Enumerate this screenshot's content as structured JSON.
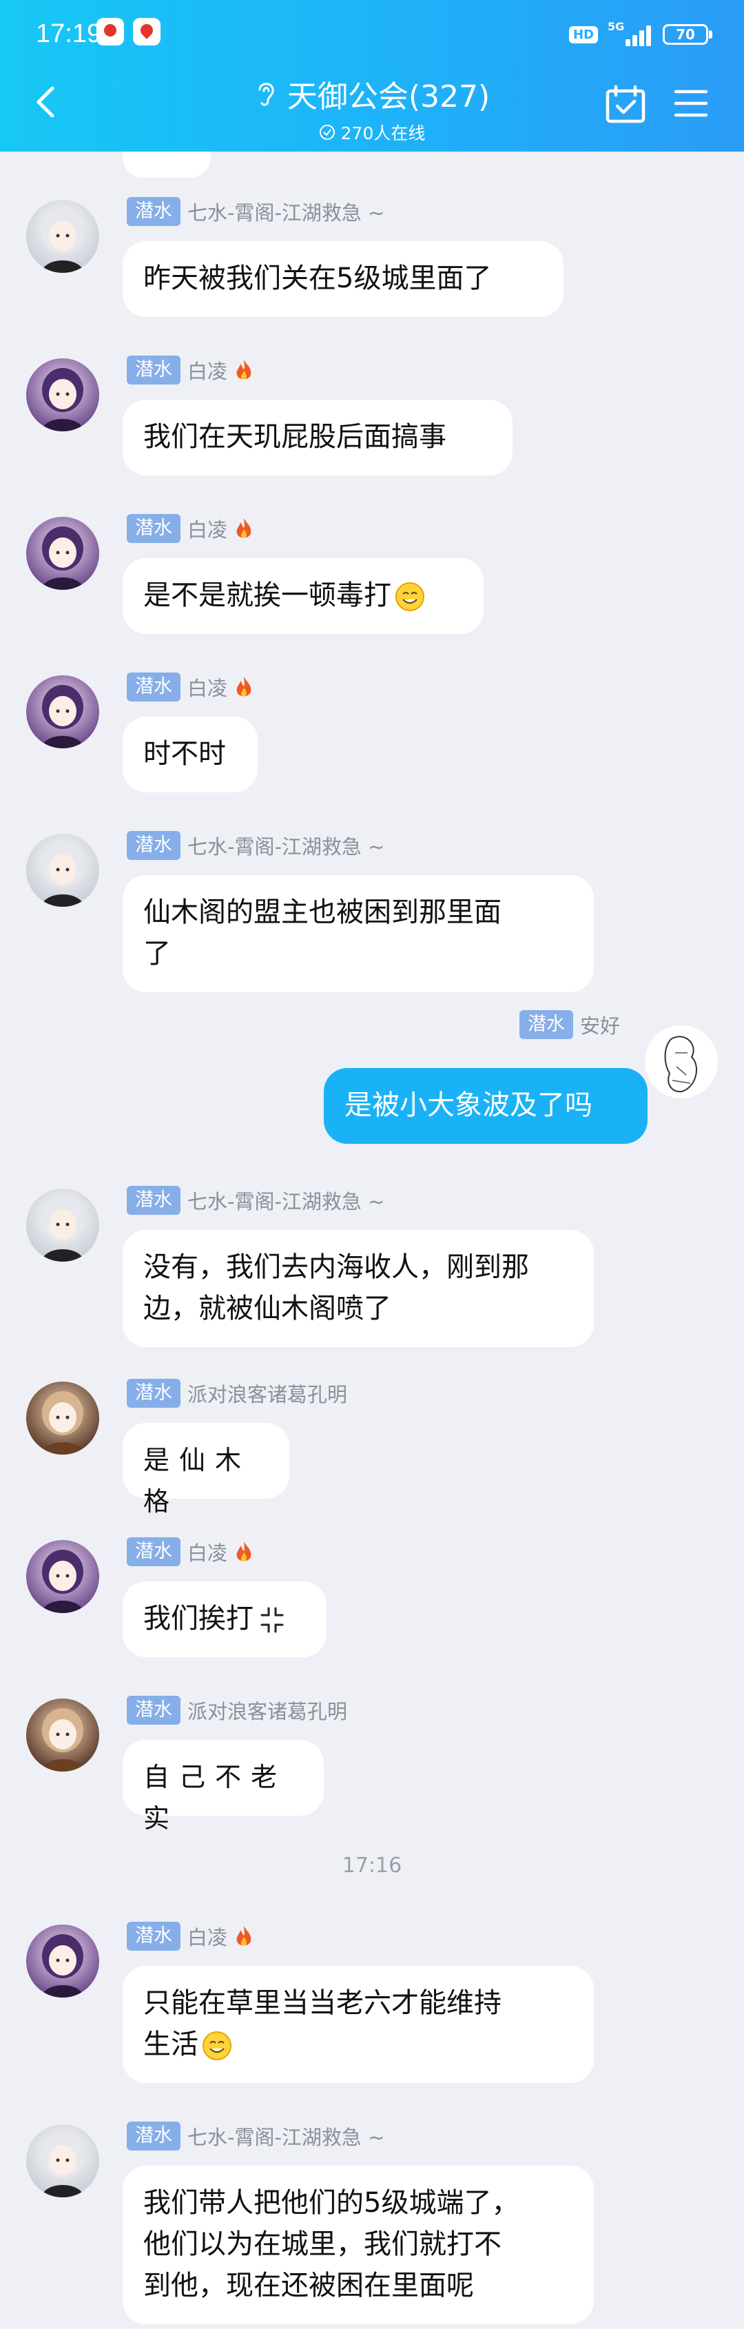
{
  "status": {
    "time": "17:19",
    "hd": "HD",
    "network": "5G",
    "battery": "70",
    "battery_level": 0.7
  },
  "header": {
    "title": "天御公会(327)",
    "online": "270人在线"
  },
  "messages": [
    {
      "tag": "潜水",
      "name": "七水-霄阁-江湖救急 ~",
      "text": "昨天被我们关在5级城里面了",
      "avatar": "silver-hair"
    },
    {
      "tag": "潜水",
      "name": "白凌",
      "fire": true,
      "text": "我们在天玑屁股后面搞事",
      "avatar": "purple-hair"
    },
    {
      "tag": "潜水",
      "name": "白凌",
      "fire": true,
      "text": "是不是就挨一顿毒打",
      "emoji": "smile",
      "avatar": "purple-hair"
    },
    {
      "tag": "潜水",
      "name": "白凌",
      "fire": true,
      "text": "时不时",
      "avatar": "purple-hair"
    },
    {
      "tag": "潜水",
      "name": "七水-霄阁-江湖救急 ~",
      "text": "仙木阁的盟主也被困到那里面\n了",
      "avatar": "silver-hair"
    },
    {
      "tag": "潜水",
      "name": "安好",
      "text": "是被小大象波及了吗",
      "mine": true,
      "avatar": "sketch"
    },
    {
      "tag": "潜水",
      "name": "七水-霄阁-江湖救急 ~",
      "text": "没有，我们去内海收人，刚到那\n边，就被仙木阁喷了",
      "avatar": "silver-hair"
    },
    {
      "tag": "潜水",
      "name": "派对浪客诸葛孔明",
      "text": "是仙木格",
      "hand": true,
      "avatar": "orange-hair"
    },
    {
      "tag": "潜水",
      "name": "白凌",
      "fire": true,
      "text": "我们挨打",
      "emoji": "anger",
      "avatar": "purple-hair"
    },
    {
      "tag": "潜水",
      "name": "派对浪客诸葛孔明",
      "text": "自己不老实",
      "hand": true,
      "avatar": "orange-hair"
    },
    {
      "tag": "潜水",
      "name": "白凌",
      "fire": true,
      "text": "只能在草里当当老六才能维持\n生活",
      "emoji": "smile",
      "avatar": "purple-hair"
    },
    {
      "tag": "潜水",
      "name": "七水-霄阁-江湖救急 ~",
      "text": "我们带人把他们的5级城端了，\n他们以为在城里，我们就打不\n到他，现在还被困在里面呢",
      "avatar": "silver-hair"
    }
  ],
  "timestamp": "17:16"
}
